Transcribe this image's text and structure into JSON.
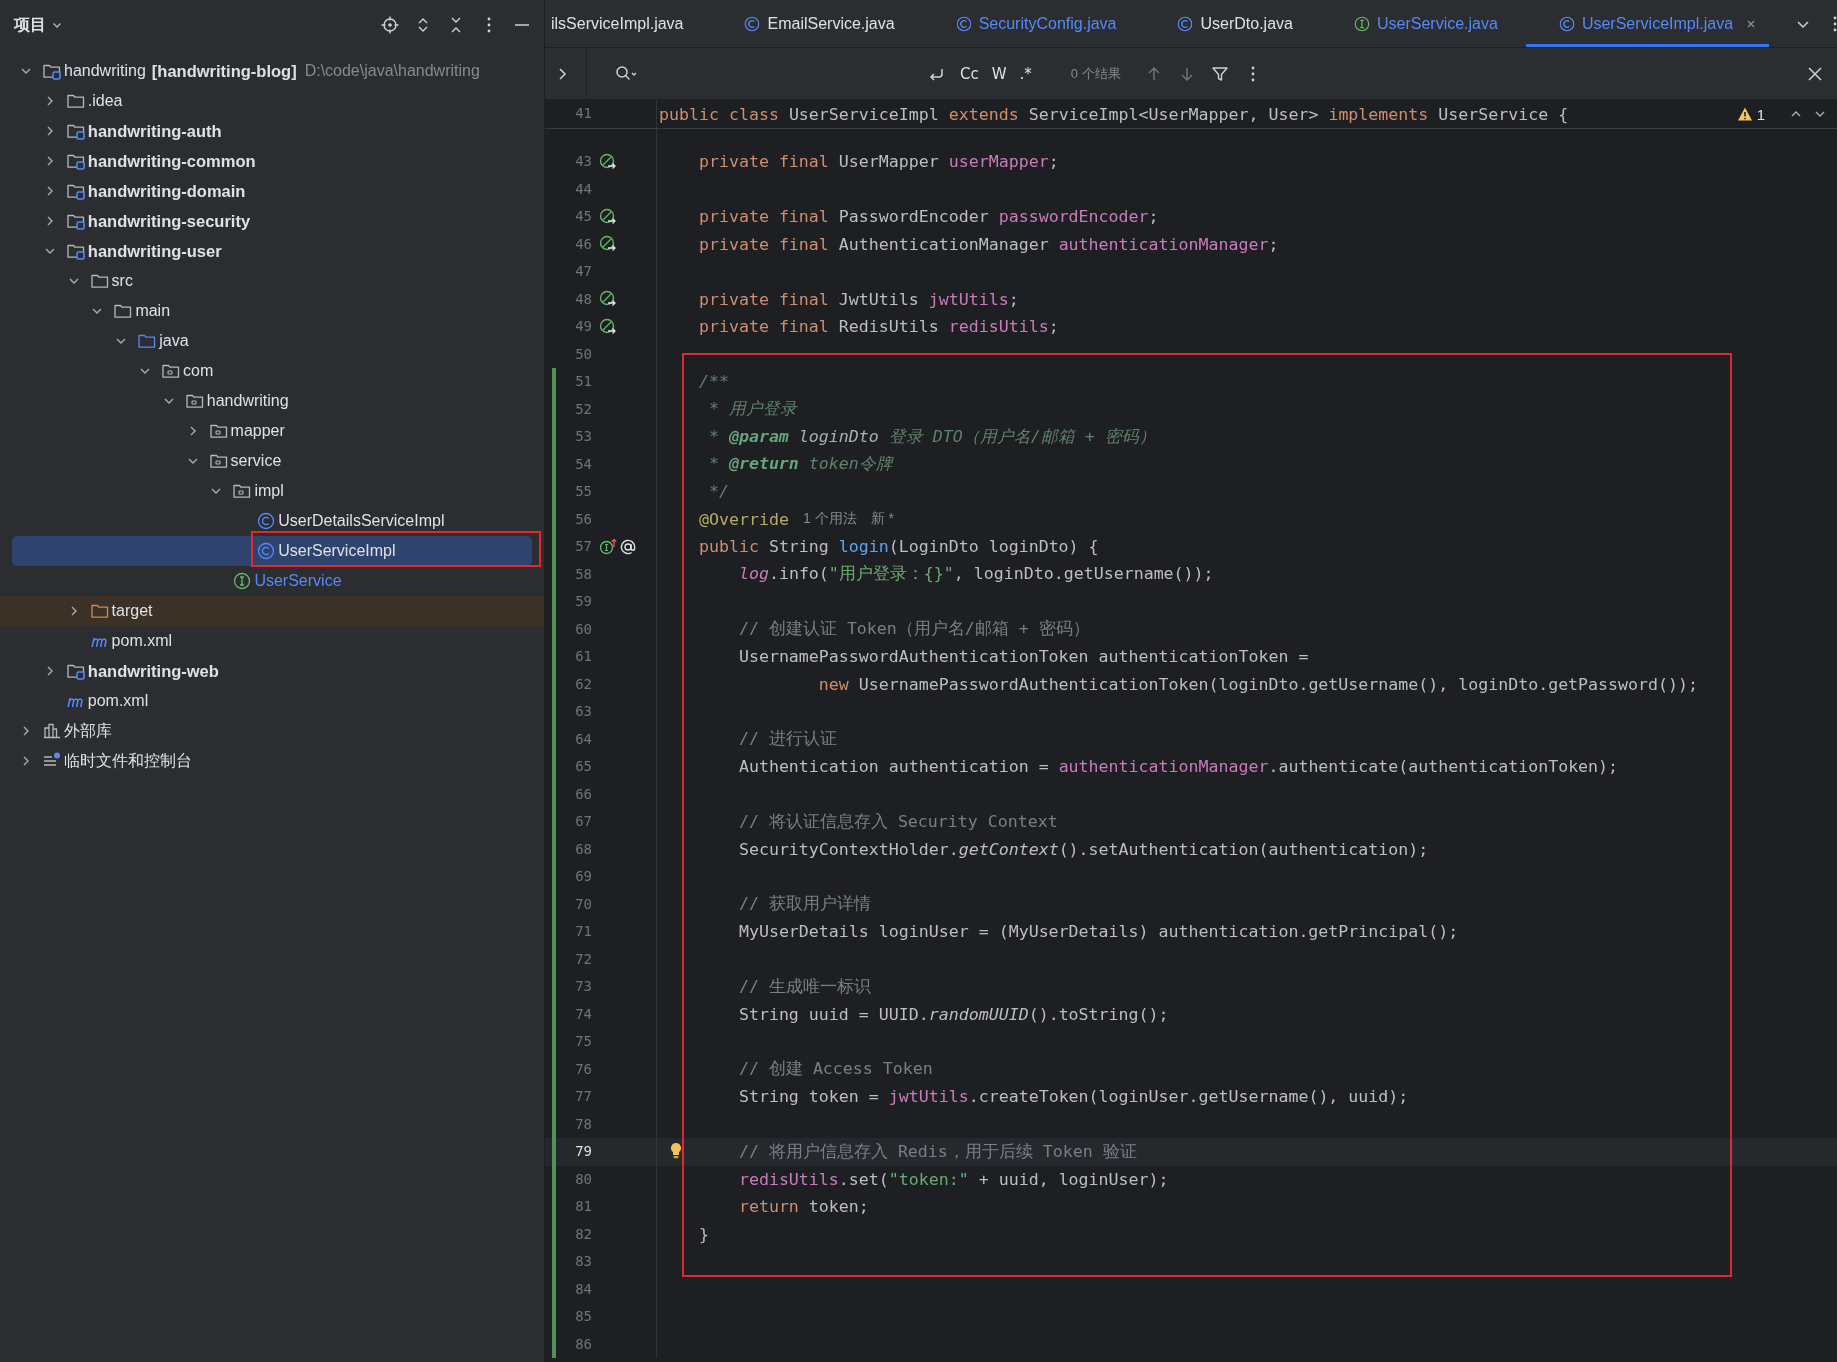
{
  "sidebar": {
    "title": "项目",
    "tree": [
      {
        "kind": "project",
        "label": "handwriting",
        "suffix": "[handwriting-blog]",
        "path": "D:\\code\\java\\handwriting",
        "expanded": true,
        "selected": false,
        "children": [
          {
            "kind": "folder",
            "label": ".idea",
            "expanded": false,
            "selected": false
          },
          {
            "kind": "module",
            "label": "handwriting-auth",
            "expanded": false,
            "selected": false
          },
          {
            "kind": "module",
            "label": "handwriting-common",
            "expanded": false,
            "selected": false
          },
          {
            "kind": "module",
            "label": "handwriting-domain",
            "expanded": false,
            "selected": false
          },
          {
            "kind": "module",
            "label": "handwriting-security",
            "expanded": false,
            "selected": false
          },
          {
            "kind": "module",
            "label": "handwriting-user",
            "expanded": true,
            "selected": false,
            "children": [
              {
                "kind": "folder",
                "label": "src",
                "expanded": true,
                "selected": false,
                "children": [
                  {
                    "kind": "folder",
                    "label": "main",
                    "expanded": true,
                    "selected": false,
                    "children": [
                      {
                        "kind": "source-folder",
                        "label": "java",
                        "expanded": true,
                        "selected": false,
                        "children": [
                          {
                            "kind": "package",
                            "label": "com",
                            "expanded": true,
                            "selected": false,
                            "children": [
                              {
                                "kind": "package",
                                "label": "handwriting",
                                "expanded": true,
                                "selected": false,
                                "children": [
                                  {
                                    "kind": "package",
                                    "label": "mapper",
                                    "expanded": false,
                                    "selected": false
                                  },
                                  {
                                    "kind": "package",
                                    "label": "service",
                                    "expanded": true,
                                    "selected": false,
                                    "children": [
                                      {
                                        "kind": "package",
                                        "label": "impl",
                                        "expanded": true,
                                        "selected": false,
                                        "children": [
                                          {
                                            "kind": "class",
                                            "label": "UserDetailsServiceImpl",
                                            "modified": false,
                                            "selected": false
                                          },
                                          {
                                            "kind": "class",
                                            "label": "UserServiceImpl",
                                            "modified": false,
                                            "selected": true
                                          }
                                        ]
                                      },
                                      {
                                        "kind": "interface",
                                        "label": "UserService",
                                        "modified": true,
                                        "selected": false
                                      }
                                    ]
                                  }
                                ]
                              }
                            ]
                          }
                        ]
                      }
                    ]
                  }
                ]
              },
              {
                "kind": "excluded-folder",
                "label": "target",
                "expanded": false,
                "selected": false
              },
              {
                "kind": "maven-file",
                "label": "pom.xml",
                "selected": false
              }
            ]
          },
          {
            "kind": "module",
            "label": "handwriting-web",
            "expanded": false,
            "selected": false
          },
          {
            "kind": "maven-file",
            "label": "pom.xml",
            "selected": false
          }
        ]
      },
      {
        "kind": "library",
        "label": "外部库",
        "expanded": false,
        "selected": false
      },
      {
        "kind": "scratches",
        "label": "临时文件和控制台",
        "expanded": false,
        "selected": false
      }
    ]
  },
  "tabs": [
    {
      "label": "ilsServiceImpl.java",
      "kind": "file",
      "modified": false,
      "selected": false
    },
    {
      "label": "EmailService.java",
      "kind": "class",
      "modified": false,
      "selected": false
    },
    {
      "label": "SecurityConfig.java",
      "kind": "class",
      "modified": true,
      "selected": false
    },
    {
      "label": "UserDto.java",
      "kind": "class",
      "modified": false,
      "selected": false
    },
    {
      "label": "UserService.java",
      "kind": "interface",
      "modified": true,
      "selected": false
    },
    {
      "label": "UserServiceImpl.java",
      "kind": "class",
      "modified": true,
      "selected": true
    }
  ],
  "find_bar": {
    "toggles": [
      "Cc",
      "W",
      ".*"
    ],
    "result": "0 个结果"
  },
  "editor": {
    "warnings": "1",
    "sticky": {
      "n": "41",
      "tokens": [
        {
          "kind": "kw",
          "text": "public class "
        },
        {
          "kind": "plain",
          "text": "UserServiceImpl "
        },
        {
          "kind": "kw",
          "text": "extends "
        },
        {
          "kind": "plain",
          "text": "ServiceImpl<UserMapper, User> "
        },
        {
          "kind": "kw",
          "text": "implements "
        },
        {
          "kind": "plain",
          "text": "UserService {"
        }
      ]
    },
    "lines": [
      {
        "n": "43",
        "changed": false,
        "current": false,
        "kind": "bean",
        "tokens": [
          {
            "kind": "kw",
            "text": "    private final "
          },
          {
            "kind": "plain",
            "text": "UserMapper "
          },
          {
            "kind": "field",
            "text": "userMapper"
          },
          {
            "kind": "plain",
            "text": ";"
          }
        ]
      },
      {
        "n": "44",
        "changed": false,
        "current": false
      },
      {
        "n": "45",
        "changed": false,
        "current": false,
        "kind": "bean",
        "tokens": [
          {
            "kind": "kw",
            "text": "    private final "
          },
          {
            "kind": "plain",
            "text": "PasswordEncoder "
          },
          {
            "kind": "field",
            "text": "passwordEncoder"
          },
          {
            "kind": "plain",
            "text": ";"
          }
        ]
      },
      {
        "n": "46",
        "changed": false,
        "current": false,
        "kind": "bean",
        "tokens": [
          {
            "kind": "kw",
            "text": "    private final "
          },
          {
            "kind": "plain",
            "text": "AuthenticationManager "
          },
          {
            "kind": "field",
            "text": "authenticationManager"
          },
          {
            "kind": "plain",
            "text": ";"
          }
        ]
      },
      {
        "n": "47",
        "changed": false,
        "current": false
      },
      {
        "n": "48",
        "changed": false,
        "current": false,
        "kind": "bean",
        "tokens": [
          {
            "kind": "kw",
            "text": "    private final "
          },
          {
            "kind": "plain",
            "text": "JwtUtils "
          },
          {
            "kind": "field",
            "text": "jwtUtils"
          },
          {
            "kind": "plain",
            "text": ";"
          }
        ]
      },
      {
        "n": "49",
        "changed": false,
        "current": false,
        "kind": "bean",
        "tokens": [
          {
            "kind": "kw",
            "text": "    private final "
          },
          {
            "kind": "plain",
            "text": "RedisUtils "
          },
          {
            "kind": "field",
            "text": "redisUtils"
          },
          {
            "kind": "plain",
            "text": ";"
          }
        ]
      },
      {
        "n": "50",
        "changed": false,
        "current": false
      },
      {
        "n": "51",
        "changed": true,
        "current": false,
        "tokens": [
          {
            "kind": "doc",
            "text": "    /**"
          }
        ]
      },
      {
        "n": "52",
        "changed": true,
        "current": false,
        "tokens": [
          {
            "kind": "doc",
            "text": "     * 用户登录"
          }
        ]
      },
      {
        "n": "53",
        "changed": true,
        "current": false,
        "tokens": [
          {
            "kind": "doc",
            "text": "     * "
          },
          {
            "kind": "doc-tag",
            "text": "@param"
          },
          {
            "kind": "doc-ref",
            "text": " loginDto"
          },
          {
            "kind": "doc",
            "text": " 登录 DTO（用户名/邮箱 + 密码）"
          }
        ]
      },
      {
        "n": "54",
        "changed": true,
        "current": false,
        "tokens": [
          {
            "kind": "doc",
            "text": "     * "
          },
          {
            "kind": "doc-tag",
            "text": "@return"
          },
          {
            "kind": "doc",
            "text": " token令牌"
          }
        ]
      },
      {
        "n": "55",
        "changed": true,
        "current": false,
        "tokens": [
          {
            "kind": "doc",
            "text": "     */"
          }
        ]
      },
      {
        "n": "56",
        "changed": true,
        "current": false,
        "hints": [
          "1 个用法",
          "新 *"
        ],
        "tokens": [
          {
            "kind": "ann",
            "text": "    @Override"
          }
        ]
      },
      {
        "n": "57",
        "changed": true,
        "current": false,
        "kind": "implements",
        "tokens": [
          {
            "kind": "kw",
            "text": "    public "
          },
          {
            "kind": "plain",
            "text": "String "
          },
          {
            "kind": "method",
            "text": "login"
          },
          {
            "kind": "plain",
            "text": "(LoginDto loginDto) {"
          }
        ]
      },
      {
        "n": "58",
        "changed": true,
        "current": false,
        "tokens": [
          {
            "kind": "static-field",
            "text": "        log"
          },
          {
            "kind": "plain",
            "text": ".info("
          },
          {
            "kind": "str",
            "text": "\"用户登录：{}\""
          },
          {
            "kind": "plain",
            "text": ", loginDto.getUsername());"
          }
        ]
      },
      {
        "n": "59",
        "changed": true,
        "current": false
      },
      {
        "n": "60",
        "changed": true,
        "current": false,
        "tokens": [
          {
            "kind": "cmt",
            "text": "        // 创建认证 Token（用户名/邮箱 + 密码）"
          }
        ]
      },
      {
        "n": "61",
        "changed": true,
        "current": false,
        "tokens": [
          {
            "kind": "plain",
            "text": "        UsernamePasswordAuthenticationToken authenticationToken ="
          }
        ]
      },
      {
        "n": "62",
        "changed": true,
        "current": false,
        "tokens": [
          {
            "kind": "kw",
            "text": "                new "
          },
          {
            "kind": "plain",
            "text": "UsernamePasswordAuthenticationToken(loginDto.getUsername(), loginDto.getPassword());"
          }
        ]
      },
      {
        "n": "63",
        "changed": true,
        "current": false
      },
      {
        "n": "64",
        "changed": true,
        "current": false,
        "tokens": [
          {
            "kind": "cmt",
            "text": "        // 进行认证"
          }
        ]
      },
      {
        "n": "65",
        "changed": true,
        "current": false,
        "tokens": [
          {
            "kind": "plain",
            "text": "        Authentication authentication = "
          },
          {
            "kind": "field",
            "text": "authenticationManager"
          },
          {
            "kind": "plain",
            "text": ".authenticate(authenticationToken);"
          }
        ]
      },
      {
        "n": "66",
        "changed": true,
        "current": false
      },
      {
        "n": "67",
        "changed": true,
        "current": false,
        "tokens": [
          {
            "kind": "cmt",
            "text": "        // 将认证信息存入 Security Context"
          }
        ]
      },
      {
        "n": "68",
        "changed": true,
        "current": false,
        "tokens": [
          {
            "kind": "plain",
            "text": "        SecurityContextHolder."
          },
          {
            "kind": "static-call",
            "text": "getContext"
          },
          {
            "kind": "plain",
            "text": "().setAuthentication(authentication);"
          }
        ]
      },
      {
        "n": "69",
        "changed": true,
        "current": false
      },
      {
        "n": "70",
        "changed": true,
        "current": false,
        "tokens": [
          {
            "kind": "cmt",
            "text": "        // 获取用户详情"
          }
        ]
      },
      {
        "n": "71",
        "changed": true,
        "current": false,
        "tokens": [
          {
            "kind": "plain",
            "text": "        MyUserDetails loginUser = (MyUserDetails) authentication.getPrincipal();"
          }
        ]
      },
      {
        "n": "72",
        "changed": true,
        "current": false
      },
      {
        "n": "73",
        "changed": true,
        "current": false,
        "tokens": [
          {
            "kind": "cmt",
            "text": "        // 生成唯一标识"
          }
        ]
      },
      {
        "n": "74",
        "changed": true,
        "current": false,
        "tokens": [
          {
            "kind": "plain",
            "text": "        String uuid = UUID."
          },
          {
            "kind": "static-call",
            "text": "randomUUID"
          },
          {
            "kind": "plain",
            "text": "().toString();"
          }
        ]
      },
      {
        "n": "75",
        "changed": true,
        "current": false
      },
      {
        "n": "76",
        "changed": true,
        "current": false,
        "tokens": [
          {
            "kind": "cmt",
            "text": "        // 创建 Access Token"
          }
        ]
      },
      {
        "n": "77",
        "changed": true,
        "current": false,
        "tokens": [
          {
            "kind": "plain",
            "text": "        String token = "
          },
          {
            "kind": "field",
            "text": "jwtUtils"
          },
          {
            "kind": "plain",
            "text": ".createToken(loginUser.getUsername(), uuid);"
          }
        ]
      },
      {
        "n": "78",
        "changed": true,
        "current": false
      },
      {
        "n": "79",
        "changed": true,
        "current": true,
        "kind": "bulb",
        "tokens": [
          {
            "kind": "cmt",
            "text": "        // 将用户信息存入 Redis，用于后续 Token 验证"
          }
        ]
      },
      {
        "n": "80",
        "changed": true,
        "current": false,
        "tokens": [
          {
            "kind": "field",
            "text": "        redisUtils"
          },
          {
            "kind": "plain",
            "text": ".set("
          },
          {
            "kind": "str",
            "text": "\"token:\""
          },
          {
            "kind": "plain",
            "text": " + uuid, loginUser);"
          }
        ]
      },
      {
        "n": "81",
        "changed": true,
        "current": false,
        "tokens": [
          {
            "kind": "kw",
            "text": "        return "
          },
          {
            "kind": "plain",
            "text": "token;"
          }
        ]
      },
      {
        "n": "82",
        "changed": true,
        "current": false,
        "tokens": [
          {
            "kind": "plain",
            "text": "    }"
          }
        ]
      },
      {
        "n": "83",
        "changed": true,
        "current": false
      },
      {
        "n": "84",
        "changed": true,
        "current": false
      },
      {
        "n": "85",
        "changed": true,
        "current": false
      },
      {
        "n": "86",
        "changed": true,
        "current": false
      }
    ]
  }
}
